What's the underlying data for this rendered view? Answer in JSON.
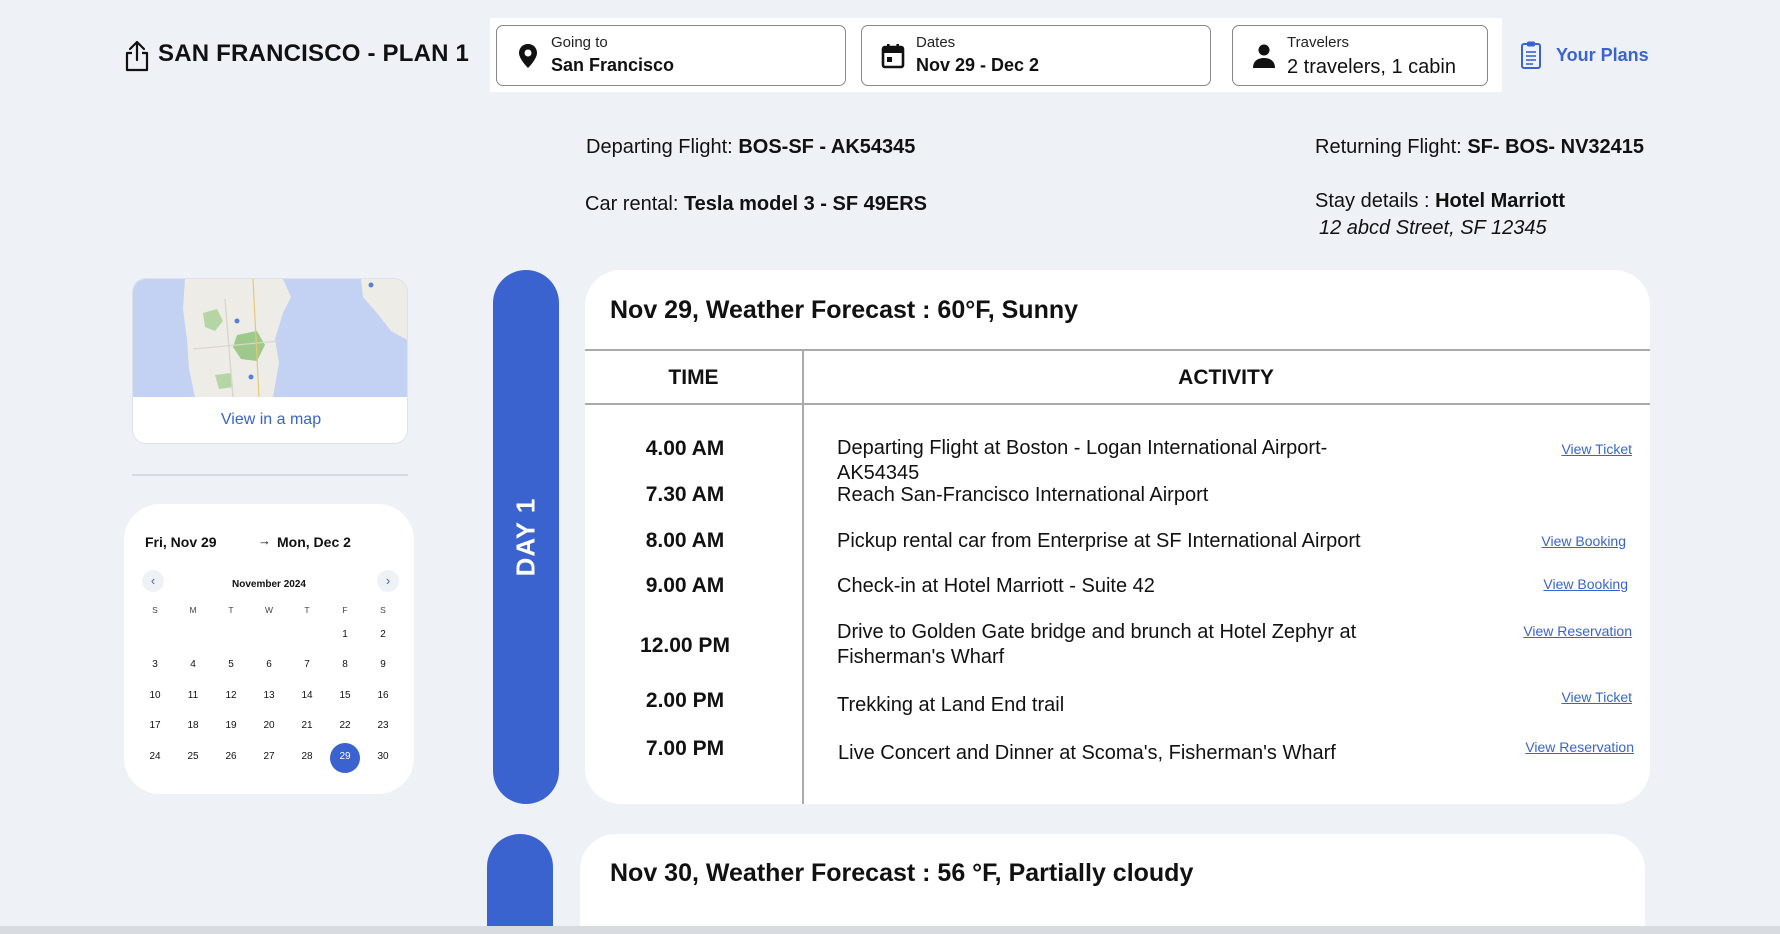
{
  "header": {
    "title": "SAN FRANCISCO - PLAN 1",
    "share_icon": "share-icon",
    "going_to": {
      "label": "Going to",
      "value": "San Francisco",
      "icon": "location-pin-icon"
    },
    "dates": {
      "label": "Dates",
      "value": "Nov 29 - Dec 2",
      "icon": "calendar-icon"
    },
    "travelers": {
      "label": "Travelers",
      "value": "2 travelers, 1 cabin",
      "icon": "person-icon"
    },
    "your_plans": {
      "label": "Your Plans",
      "icon": "clipboard-icon"
    }
  },
  "trip": {
    "departing_label": "Departing Flight:",
    "departing_value": "BOS-SF - AK54345",
    "car_label": "Car rental:",
    "car_value": "Tesla model 3 - SF 49ERS",
    "returning_label": "Returning Flight:",
    "returning_value": "SF- BOS- NV32415",
    "stay_label": "Stay details :",
    "stay_value": "Hotel Marriott",
    "stay_address": "12 abcd  Street, SF 12345"
  },
  "map": {
    "link": "View in a map"
  },
  "calendar": {
    "start": "Fri, Nov 29",
    "arrow": "→",
    "end": "Mon, Dec 2",
    "month": "November 2024",
    "weekdays": [
      "S",
      "M",
      "T",
      "W",
      "T",
      "F",
      "S"
    ],
    "weeks": [
      [
        "",
        "",
        "",
        "",
        "",
        "1",
        "2"
      ],
      [
        "3",
        "4",
        "5",
        "6",
        "7",
        "8",
        "9"
      ],
      [
        "10",
        "11",
        "12",
        "13",
        "14",
        "15",
        "16"
      ],
      [
        "17",
        "18",
        "19",
        "20",
        "21",
        "22",
        "23"
      ],
      [
        "24",
        "25",
        "26",
        "27",
        "28",
        "29",
        "30"
      ]
    ],
    "selected": "29",
    "prev": "‹",
    "next": "›",
    "accent": "#3a63d0"
  },
  "day1": {
    "label": "DAY 1",
    "title": "Nov 29, Weather Forecast : 60°F, Sunny",
    "col_time": "TIME",
    "col_activity": "ACTIVITY",
    "activities": [
      {
        "time": "4.00 AM",
        "activity": "Departing Flight at Boston - Logan International Airport- AK54345",
        "link": "View Ticket"
      },
      {
        "time": "7.30 AM",
        "activity": "Reach San-Francisco International Airport",
        "link": ""
      },
      {
        "time": "8.00 AM",
        "activity": "Pickup rental car from Enterprise at SF International Airport",
        "link": "View Booking"
      },
      {
        "time": "9.00 AM",
        "activity": "Check-in at Hotel Marriott - Suite 42",
        "link": "View Booking"
      },
      {
        "time": "12.00 PM",
        "activity": "Drive to Golden Gate bridge and brunch at Hotel Zephyr at Fisherman's Wharf",
        "link": "View Reservation"
      },
      {
        "time": "2.00 PM",
        "activity": "Trekking at Land End trail",
        "link": "View Ticket"
      },
      {
        "time": "7.00 PM",
        "activity": "Live Concert and Dinner at Scoma's, Fisherman's Wharf",
        "link": "View Reservation"
      }
    ]
  },
  "day2": {
    "title": "Nov 30, Weather Forecast : 56 °F, Partially cloudy"
  }
}
